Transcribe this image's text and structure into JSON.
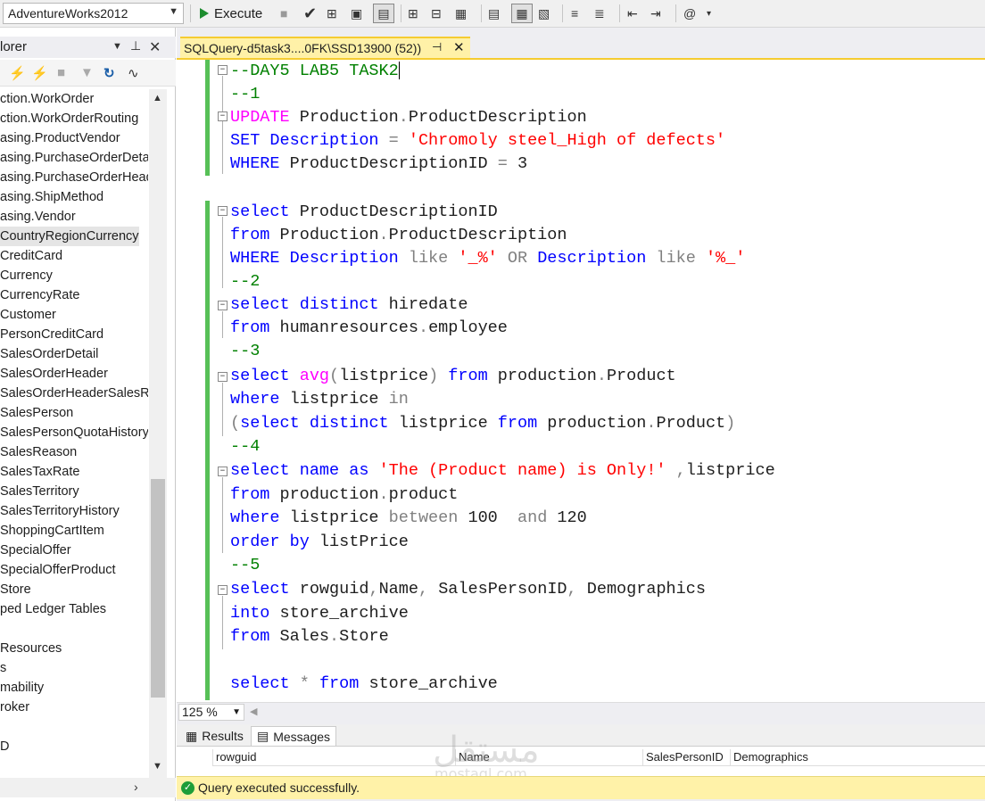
{
  "toolbar": {
    "database": "AdventureWorks2012",
    "execute_label": "Execute"
  },
  "object_explorer": {
    "title": "lorer",
    "items": [
      "ction.WorkOrder",
      "ction.WorkOrderRouting",
      "asing.ProductVendor",
      "asing.PurchaseOrderDetai",
      "asing.PurchaseOrderHead",
      "asing.ShipMethod",
      "asing.Vendor",
      "CountryRegionCurrency",
      "CreditCard",
      "Currency",
      "CurrencyRate",
      "Customer",
      "PersonCreditCard",
      "SalesOrderDetail",
      "SalesOrderHeader",
      "SalesOrderHeaderSalesRe",
      "SalesPerson",
      "SalesPersonQuotaHistory",
      "SalesReason",
      "SalesTaxRate",
      "SalesTerritory",
      "SalesTerritoryHistory",
      "ShoppingCartItem",
      "SpecialOffer",
      "SpecialOfferProduct",
      "Store",
      "ped Ledger Tables",
      "",
      "Resources",
      "s",
      "mability",
      "roker",
      "",
      "D"
    ]
  },
  "editor_tab": {
    "title": "SQLQuery-d5task3....0FK\\SSD13900 (52))"
  },
  "code_lines": {
    "l1": "--DAY5 LAB5 TASK2",
    "l2": "--1",
    "l3a": "UPDATE",
    "l3b": " Production",
    "l3c": ".",
    "l3d": "ProductDescription",
    "l4a": "SET",
    "l4b": " Description ",
    "l4c": "=",
    "l4d": " 'Chromoly steel_High of defects'",
    "l5a": "WHERE",
    "l5b": " ProductDescriptionID ",
    "l5c": "=",
    "l5d": " 3",
    "l7a": "select",
    "l7b": " ProductDescriptionID",
    "l8a": "from",
    "l8b": " Production",
    "l8c": ".",
    "l8d": "ProductDescription",
    "l9a": "WHERE",
    "l9b": " Description ",
    "l9c": "like",
    "l9d": " '_%'",
    "l9e": " OR",
    "l9f": " Description ",
    "l9g": "like",
    "l9h": " '%_'",
    "l10": "--2",
    "l11a": "select",
    "l11b": " distinct",
    "l11c": " hiredate",
    "l12a": "from",
    "l12b": " humanresources",
    "l12c": ".",
    "l12d": "employee",
    "l13": "--3",
    "l14a": "select",
    "l14b": " avg",
    "l14c": "(",
    "l14d": "listprice",
    "l14e": ")",
    "l14f": " from",
    "l14g": " production",
    "l14h": ".",
    "l14i": "Product",
    "l15a": "where",
    "l15b": " listprice ",
    "l15c": "in",
    "l16a": "(",
    "l16b": "select",
    "l16c": " distinct",
    "l16d": " listprice ",
    "l16e": "from",
    "l16f": " production",
    "l16g": ".",
    "l16h": "Product",
    "l16i": ")",
    "l17": "--4",
    "l18a": "select",
    "l18b": " name ",
    "l18c": "as",
    "l18d": " 'The (Product name) is Only!'",
    "l18e": " ,",
    "l18f": "listprice",
    "l19a": "from",
    "l19b": " production",
    "l19c": ".",
    "l19d": "product",
    "l20a": "where",
    "l20b": " listprice ",
    "l20c": "between",
    "l20d": " 100  ",
    "l20e": "and",
    "l20f": " 120",
    "l21a": "order by",
    "l21b": " listPrice",
    "l22": "--5",
    "l23a": "select",
    "l23b": " rowguid",
    "l23c": ",",
    "l23d": "Name",
    "l23e": ",",
    "l23f": " SalesPersonID",
    "l23g": ",",
    "l23h": " Demographics",
    "l24a": "into",
    "l24b": " store_archive",
    "l25a": "from",
    "l25b": " Sales",
    "l25c": ".",
    "l25d": "Store",
    "l27a": "select",
    "l27b": " *",
    "l27c": " from",
    "l27d": " store_archive"
  },
  "zoom": "125 %",
  "results": {
    "tab_results": "Results",
    "tab_messages": "Messages",
    "columns": [
      "rowguid",
      "Name",
      "SalesPersonID",
      "Demographics"
    ]
  },
  "status": {
    "message": "Query executed successfully."
  },
  "watermark": {
    "arabic": "مستقل",
    "latin": "mostaql.com"
  }
}
